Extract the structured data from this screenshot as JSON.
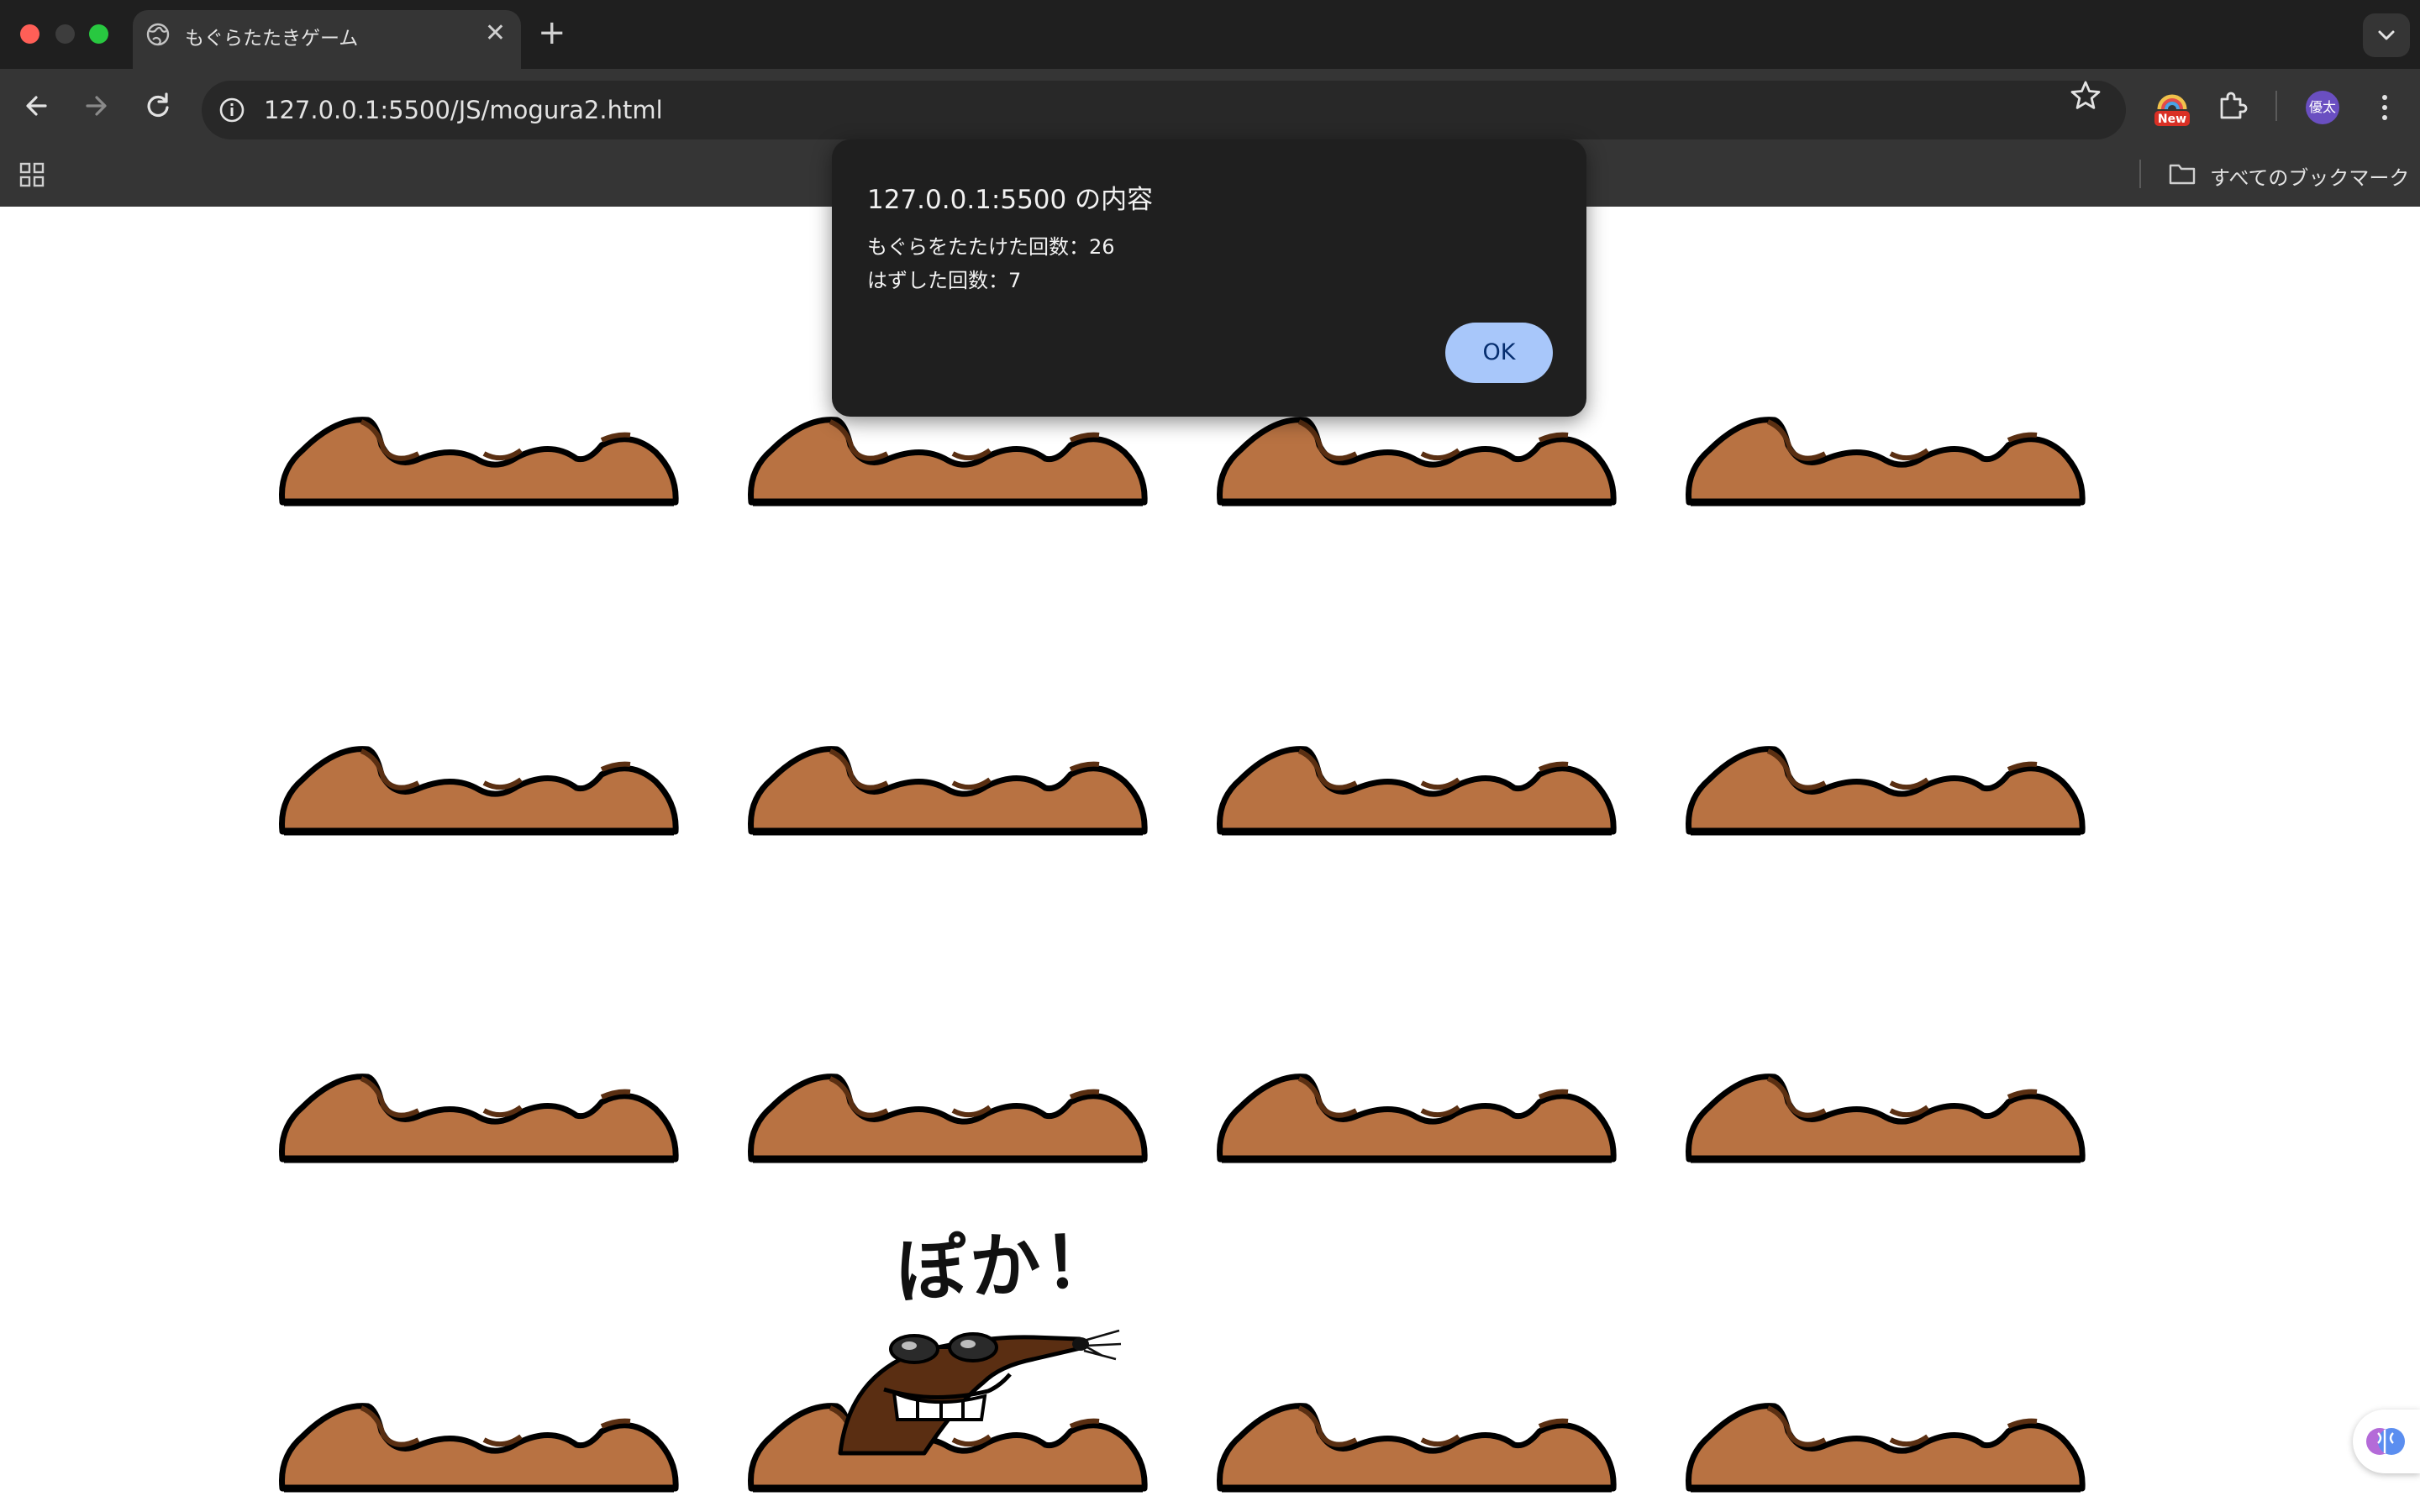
{
  "browser": {
    "tab_title": "もぐらたたきゲーム",
    "tab_close": "✕",
    "new_tab": "+",
    "url": "127.0.0.1:5500/JS/mogura2.html",
    "ext_badge": "New",
    "avatar_initials": "優太",
    "bookmarks_label": "すべてのブックマーク"
  },
  "dialog": {
    "title": "127.0.0.1:5500 の内容",
    "line1": "もぐらをたたけた回数：26",
    "line2": "はずした回数：7",
    "ok_label": "OK"
  },
  "game": {
    "hit_text": "ぽか！",
    "grid_rows": 4,
    "grid_cols": 4,
    "mole_hole": {
      "row": 4,
      "col": 2
    },
    "hits": 26,
    "misses": 7
  },
  "colors": {
    "mound_fill": "#b87242",
    "mound_shadow": "#5a2f12",
    "mole_body": "#5a2e12",
    "dialog_bg": "#1f1f1f",
    "ok_button": "#a8c7fa"
  }
}
